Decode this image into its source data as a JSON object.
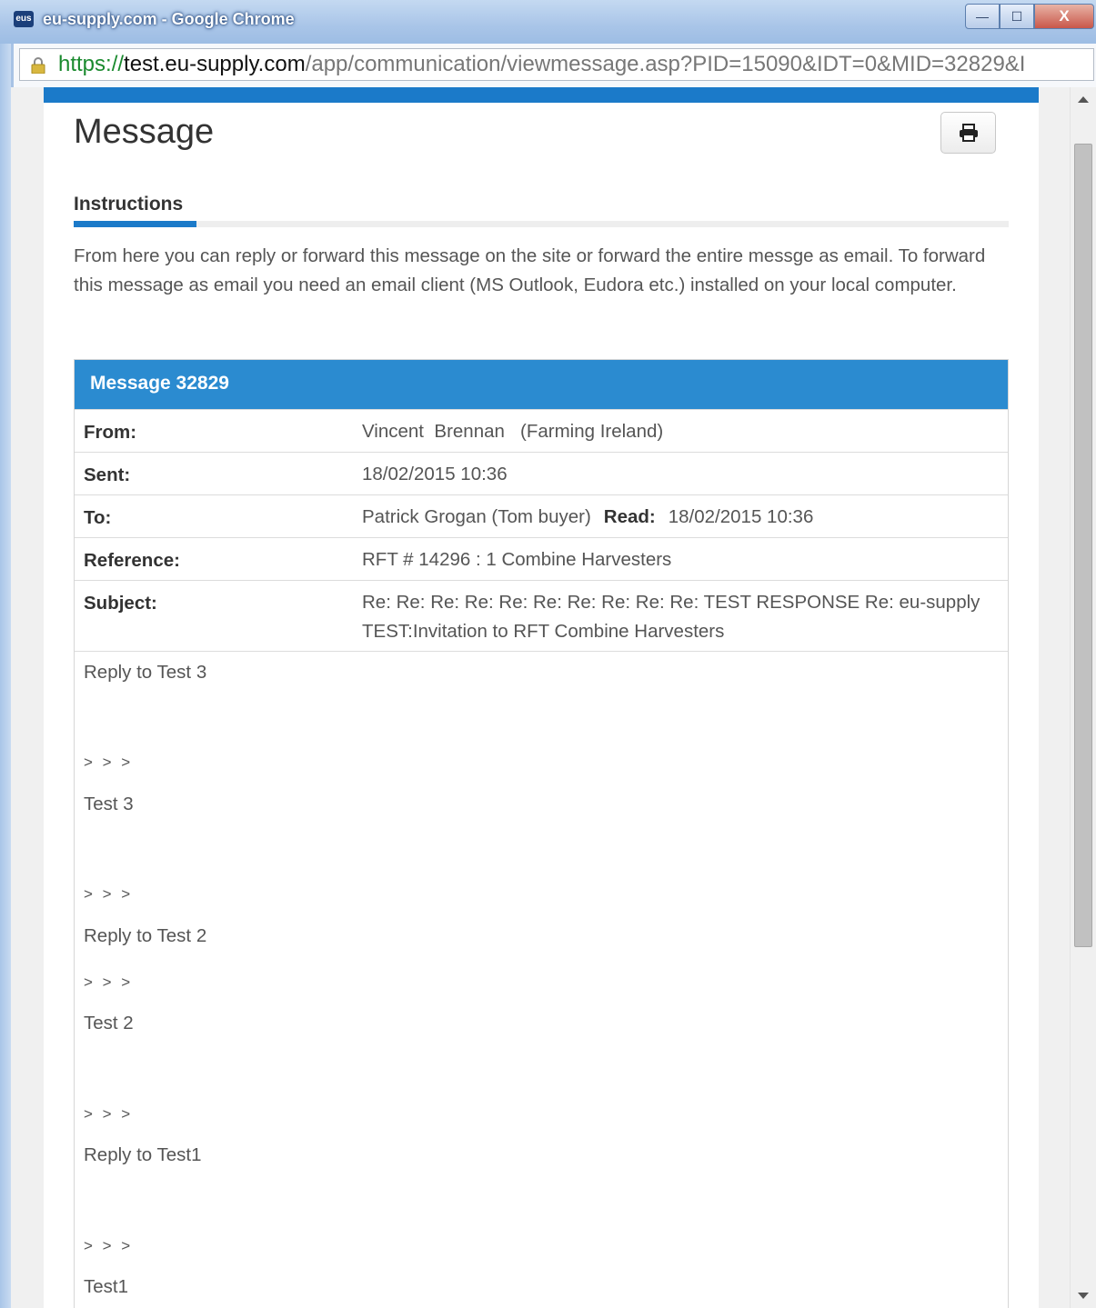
{
  "window": {
    "title": "eu-supply.com - Google Chrome",
    "favicon_text": "eus",
    "controls": {
      "minimize": "—",
      "maximize": "☐",
      "close": "X"
    }
  },
  "address_bar": {
    "scheme": "https://",
    "host": "test.eu-supply.com",
    "path": "/app/communication/viewmessage.asp?PID=15090&IDT=0&MID=32829&I"
  },
  "page": {
    "title": "Message",
    "print_icon": "printer-icon",
    "instructions_tab": "Instructions",
    "instructions_text": "From here you can reply or forward this message on the site or forward the entire messge as email. To forward this message as email you need an email client (MS Outlook, Eudora etc.) installed on your local computer."
  },
  "message": {
    "header": "Message 32829",
    "fields": {
      "from_label": "From:",
      "from_value": "Vincent  Brennan   (Farming Ireland)",
      "sent_label": "Sent:",
      "sent_value": "18/02/2015 10:36",
      "to_label": "To:",
      "to_value": "Patrick Grogan (Tom buyer)",
      "read_label": "Read:",
      "read_value": "18/02/2015 10:36",
      "reference_label": "Reference:",
      "reference_value": "RFT # 14296 : 1 Combine Harvesters",
      "subject_label": "Subject:",
      "subject_value": "Re: Re: Re: Re: Re: Re: Re: Re: Re: Re: TEST RESPONSE Re: eu-supply TEST:Invitation to RFT Combine Harvesters"
    },
    "body": [
      "Reply to Test 3",
      "> > >",
      "Test 3",
      "> > >",
      "Reply to Test 2",
      "> > >",
      "Test 2",
      "> > >",
      "Reply to Test1",
      "> > >",
      "Test1"
    ]
  },
  "colors": {
    "accent": "#1b7ac9",
    "message_header": "#2b8bd0"
  }
}
